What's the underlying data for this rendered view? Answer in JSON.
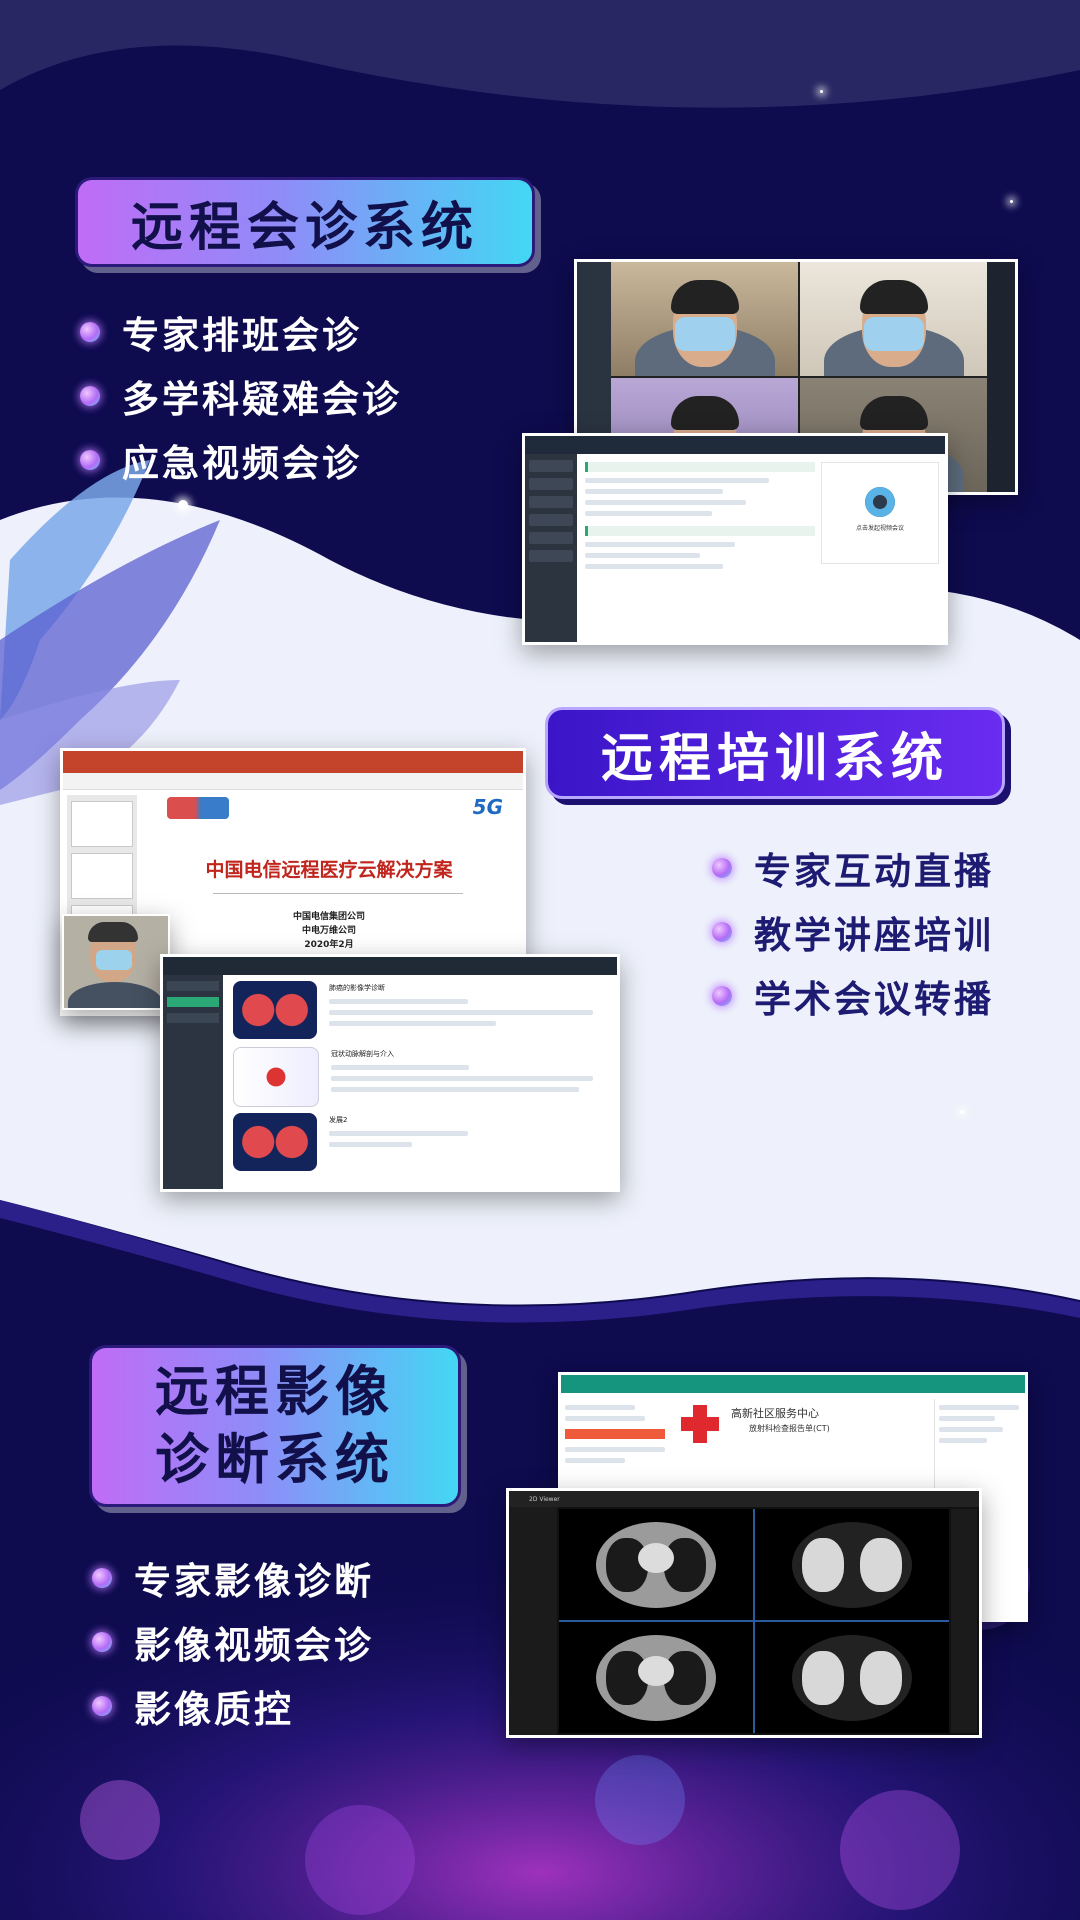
{
  "sections": [
    {
      "title": "远程会诊系统",
      "items": [
        "专家排班会诊",
        "多学科疑难会诊",
        "应急视频会诊"
      ]
    },
    {
      "title": "远程培训系统",
      "items": [
        "专家互动直播",
        "教学讲座培训",
        "学术会议转播"
      ]
    },
    {
      "title_line1": "远程影像",
      "title_line2": "诊断系统",
      "items": [
        "专家影像诊断",
        "影像视频会诊",
        "影像质控"
      ]
    }
  ],
  "screenshots": {
    "consultation_call": {
      "button": "点击发起视频会议"
    },
    "training_ppt": {
      "badge": "5G",
      "title": "中国电信远程医疗云解决方案",
      "org1": "中国电信集团公司",
      "org2": "中电万维公司",
      "date": "2020年2月"
    },
    "course_list": {
      "items": [
        "肺癌的影像学诊断",
        "冠状动脉解剖与介入",
        "发展2"
      ]
    },
    "radiology_report": {
      "center": "高新社区服务中心",
      "report": "放射科检查报告单(CT)",
      "viewer": "2D Viewer"
    }
  },
  "colors": {
    "navy": "#0d0a4a",
    "accent_purple": "#b36af6",
    "accent_cyan": "#43d7f4",
    "dark_badge": "#4d1fd9"
  }
}
